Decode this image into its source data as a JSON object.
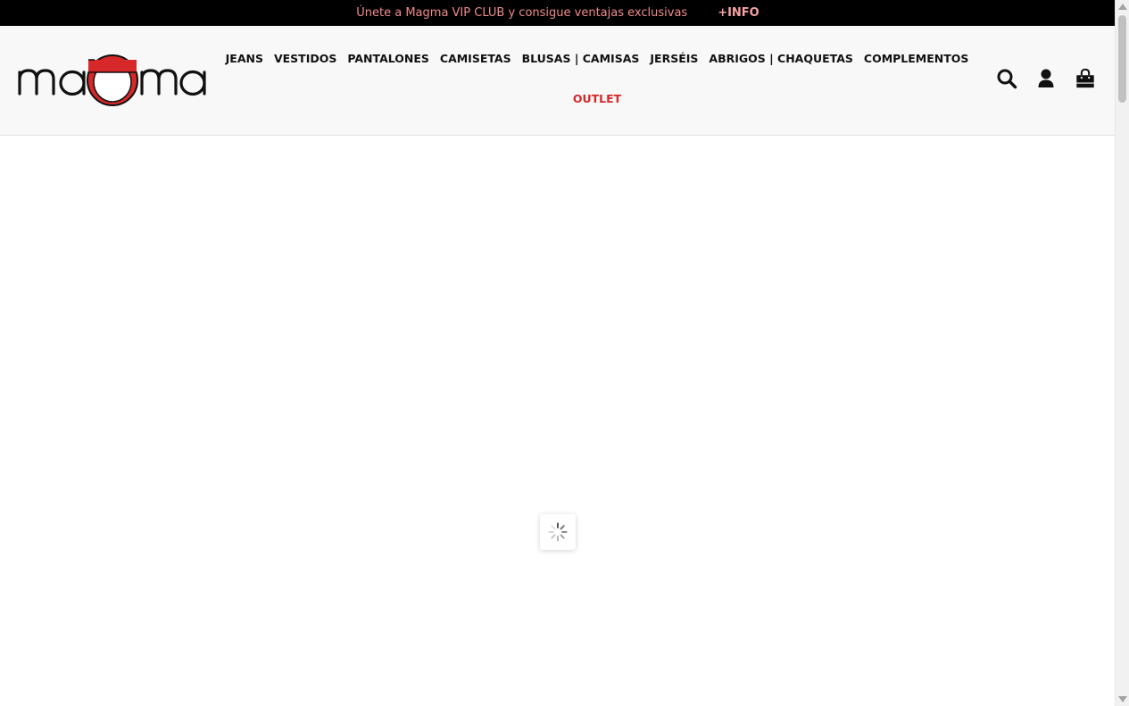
{
  "promo": {
    "text": "Únete a Magma VIP CLUB y consigue ventajas exclusivas",
    "link": "+INFO"
  },
  "logo": {
    "text": "maGma",
    "brand_color": "#d62828"
  },
  "nav": {
    "items": [
      {
        "label": "JEANS"
      },
      {
        "label": "VESTIDOS"
      },
      {
        "label": "PANTALONES"
      },
      {
        "label": "CAMISETAS"
      },
      {
        "label": "BLUSAS | CAMISAS"
      },
      {
        "label": "JERSÉIS"
      },
      {
        "label": "ABRIGOS | CHAQUETAS"
      },
      {
        "label": "COMPLEMENTOS"
      }
    ],
    "outlet": {
      "label": "OUTLET",
      "color": "#d62828"
    }
  },
  "icons": {
    "search": "search-icon",
    "account": "user-icon",
    "cart": "shopping-bag-icon"
  },
  "colors": {
    "promo_bg": "#000000",
    "promo_text": "#f08a8a",
    "header_bg": "#f8f8f8",
    "accent": "#d62828"
  }
}
